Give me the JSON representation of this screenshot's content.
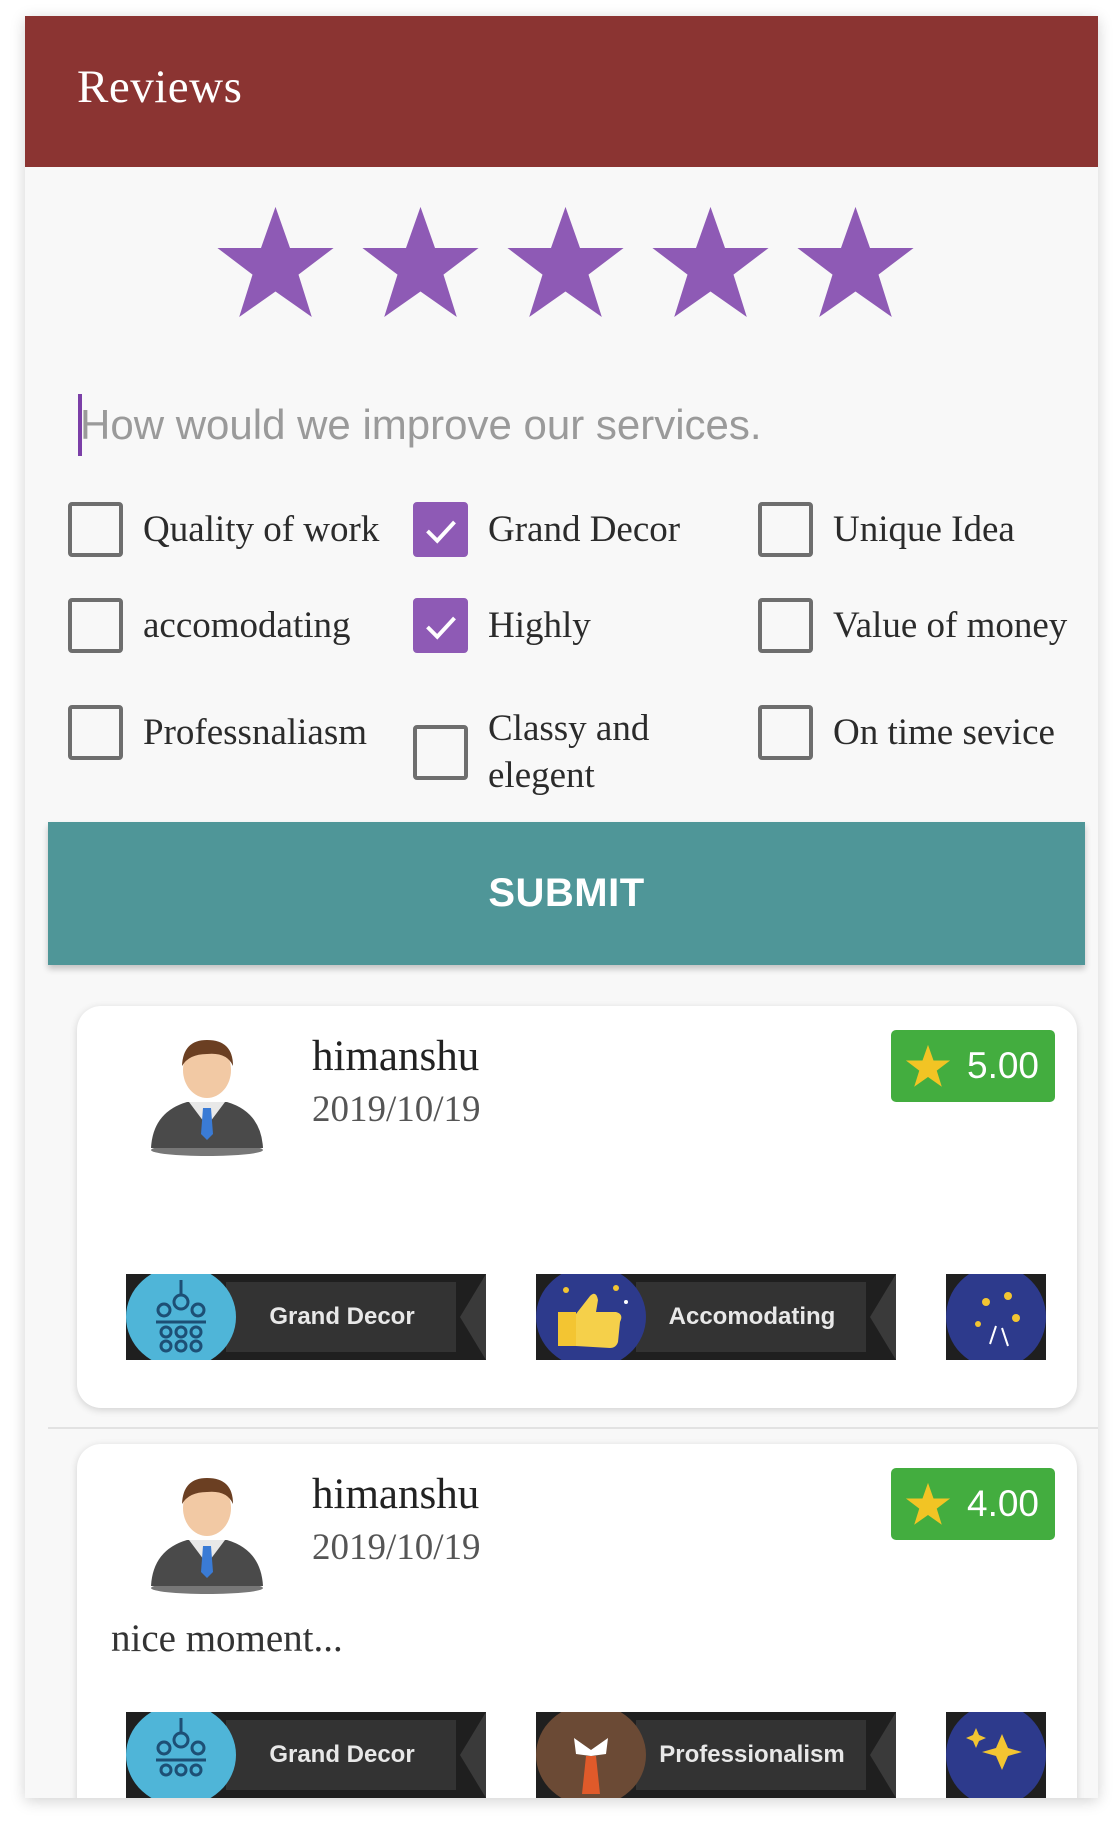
{
  "appbar": {
    "title": "Reviews"
  },
  "rating": {
    "value": 5,
    "max": 5,
    "star_color": "#8e5ab5"
  },
  "comment": {
    "placeholder": "How would we improve our services.",
    "value": ""
  },
  "tags": [
    {
      "label": "Quality of work",
      "checked": false
    },
    {
      "label": "Grand Decor",
      "checked": true
    },
    {
      "label": "Unique Idea",
      "checked": false
    },
    {
      "label": "accomodating",
      "checked": false
    },
    {
      "label": "Highly",
      "checked": true
    },
    {
      "label": "Value of money",
      "checked": false
    },
    {
      "label": "Professnaliasm",
      "checked": false
    },
    {
      "label": "Classy and elegent",
      "checked": false
    },
    {
      "label": "On time sevice",
      "checked": false
    }
  ],
  "submit_label": "SUBMIT",
  "reviews": [
    {
      "name": "himanshu",
      "date": "2019/10/19",
      "rating": "5.00",
      "text": "",
      "badges": [
        "Grand Decor",
        "Accomodating",
        ""
      ]
    },
    {
      "name": "himanshu",
      "date": "2019/10/19",
      "rating": "4.00",
      "text": "nice moment...",
      "badges": [
        "Grand Decor",
        "Professionalism",
        ""
      ]
    }
  ],
  "colors": {
    "appbar": "#8b3432",
    "accent": "#8e5ab5",
    "submit": "#4f9698",
    "rating_badge": "#43ad3f"
  }
}
